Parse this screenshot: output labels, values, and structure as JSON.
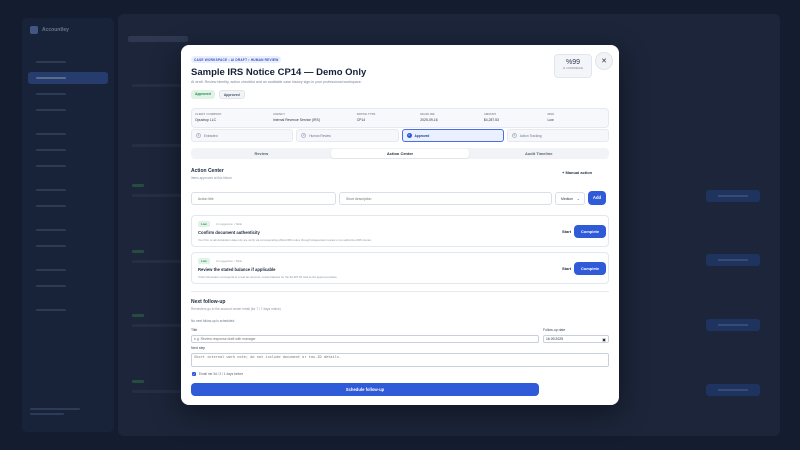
{
  "background": {
    "brand": "Accountley"
  },
  "modal": {
    "breadcrumb": "CASE WORKSPACE • AI DRAFT • HUMAN REVIEW",
    "title": "Sample IRS Notice CP14 — Demo Only",
    "subtitle": "AI draft. Review identity, action checklist and an auditable case history sign-in your professional workspace.",
    "status_badges": [
      "Approved",
      "Approved"
    ],
    "confidence": {
      "value": "%99",
      "label": "AI CONFIDENCE"
    },
    "close_icon": "close-icon",
    "meta": [
      {
        "key": "CLIENT / COMPANY",
        "value": "Opustrup LLC"
      },
      {
        "key": "AGENCY",
        "value": "Internal Revenue Service (IRS)"
      },
      {
        "key": "NOTICE TYPE",
        "value": "CP14"
      },
      {
        "key": "DEADLINE",
        "value": "2025-09-16"
      },
      {
        "key": "AMOUNT",
        "value": "$4,287.53"
      },
      {
        "key": "RISK",
        "value": "Low"
      }
    ],
    "steps": [
      {
        "num": "1",
        "label": "Extracted",
        "active": false
      },
      {
        "num": "2",
        "label": "Human Review",
        "active": false
      },
      {
        "num": "3",
        "label": "Approved",
        "active": true
      },
      {
        "num": "4",
        "label": "Action Tracking",
        "active": false
      }
    ],
    "tabs": [
      {
        "label": "Review",
        "active": false
      },
      {
        "label": "Action Center",
        "active": true
      },
      {
        "label": "Audit Timeline",
        "active": false
      }
    ],
    "action_center": {
      "title": "Action Center",
      "subtitle": "Items approved at this fixture",
      "manual_label": "+ Manual action",
      "title_placeholder": "Action title",
      "desc_placeholder": "Short description",
      "priority": "Medium",
      "add_label": "Add",
      "tasks": [
        {
          "priority": "Low",
          "source": "AI suggestion • Table",
          "title": "Confirm document authenticity",
          "desc": "Your firm or administration data only are verify via corresponding official IRS notice through independent review or an authorized IRS Center.",
          "start": "Start",
          "complete": "Complete"
        },
        {
          "priority": "Low",
          "source": "AI suggestion • Table",
          "title": "Review the stated balance if applicable",
          "desc": "If this information correspond to a real tax account, review balance for the $4,287.53 total at the approved status.",
          "start": "Start",
          "complete": "Complete"
        }
      ]
    },
    "follow_up": {
      "title": "Next follow-up",
      "subtitle": "Reminders go to the account owner email (for 7 / 7 days notice)",
      "none_text": "No next follow-up is scheduled.",
      "title_label": "Title",
      "title_placeholder": "e.g. Review response draft with manager",
      "date_label": "Follow-up date",
      "date_value": "16.09.2025",
      "next_step_label": "Next step",
      "next_step_placeholder": "Short internal work note; do not include document or tax-ID details.",
      "checkbox_label": "Email me 3d / 2 / 1 days before",
      "schedule_label": "Schedule follow-up"
    }
  }
}
